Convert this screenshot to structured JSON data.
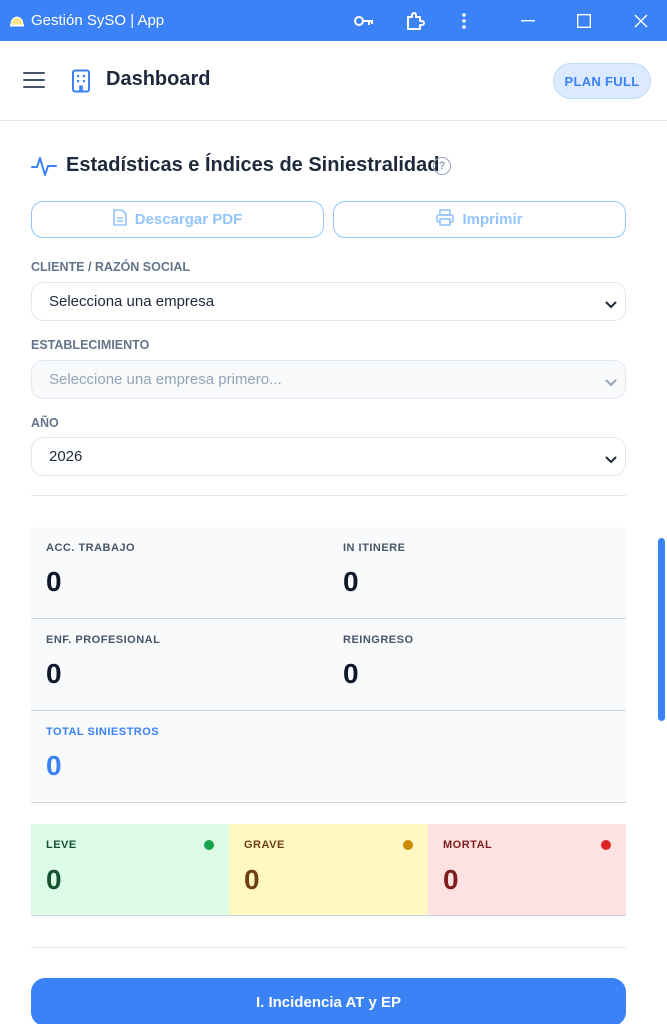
{
  "window": {
    "title": "Gestión SySO | App"
  },
  "header": {
    "title": "Dashboard",
    "plan_badge": "PLAN FULL"
  },
  "section": {
    "title": "Estadísticas e Índices de Siniestralidad",
    "help": "?",
    "download_pdf": "Descargar PDF",
    "print": "Imprimir"
  },
  "form": {
    "cliente_label": "CLIENTE / RAZÓN SOCIAL",
    "cliente_value": "Selecciona una empresa",
    "establecimiento_label": "ESTABLECIMIENTO",
    "establecimiento_value": "Seleccione una empresa primero...",
    "anio_label": "AÑO",
    "anio_value": "2026"
  },
  "stats": {
    "acc_trabajo": {
      "label": "ACC. TRABAJO",
      "value": "0"
    },
    "in_itinere": {
      "label": "IN ITINERE",
      "value": "0"
    },
    "enf_profesional": {
      "label": "ENF. PROFESIONAL",
      "value": "0"
    },
    "reingreso": {
      "label": "REINGRESO",
      "value": "0"
    },
    "total": {
      "label": "TOTAL SINIESTROS",
      "value": "0"
    }
  },
  "severity": {
    "leve": {
      "label": "LEVE",
      "value": "0",
      "color": "#16a34a"
    },
    "grave": {
      "label": "GRAVE",
      "value": "0",
      "color": "#ca8a04"
    },
    "mortal": {
      "label": "MORTAL",
      "value": "0",
      "color": "#dc2626"
    }
  },
  "actions": {
    "incidencia": "I. Incidencia AT y EP"
  },
  "colors": {
    "accent": "#3b82f6"
  }
}
